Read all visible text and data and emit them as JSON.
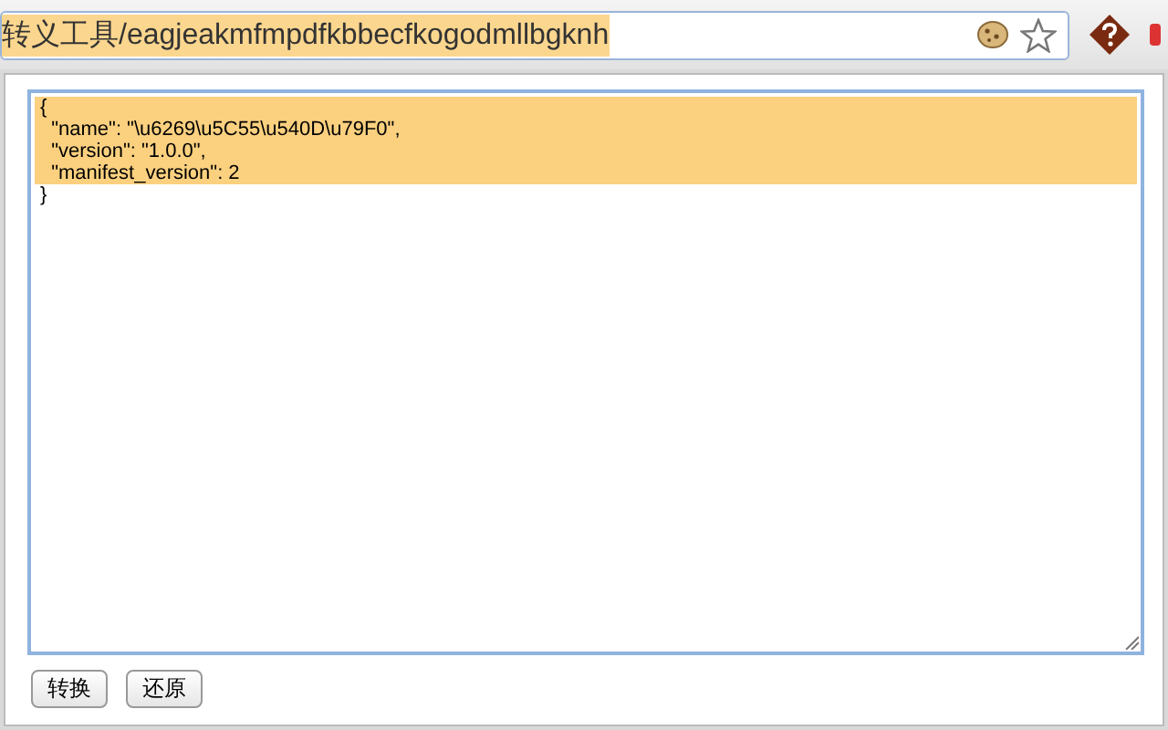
{
  "address_bar": {
    "text": "转义工具/eagjeakmfmpdfkbbecfkogodmllbgknh",
    "selected": true
  },
  "popup": {
    "editor_lines": [
      {
        "text": "{",
        "selected": true
      },
      {
        "text": "  \"name\": \"\\u6269\\u5C55\\u540D\\u79F0\",",
        "selected": true
      },
      {
        "text": "  \"version\": \"1.0.0\",",
        "selected": true
      },
      {
        "text": "  \"manifest_version\": 2",
        "selected": true
      },
      {
        "text": "}",
        "selected": false
      }
    ],
    "buttons": [
      "转换",
      "还原"
    ]
  }
}
